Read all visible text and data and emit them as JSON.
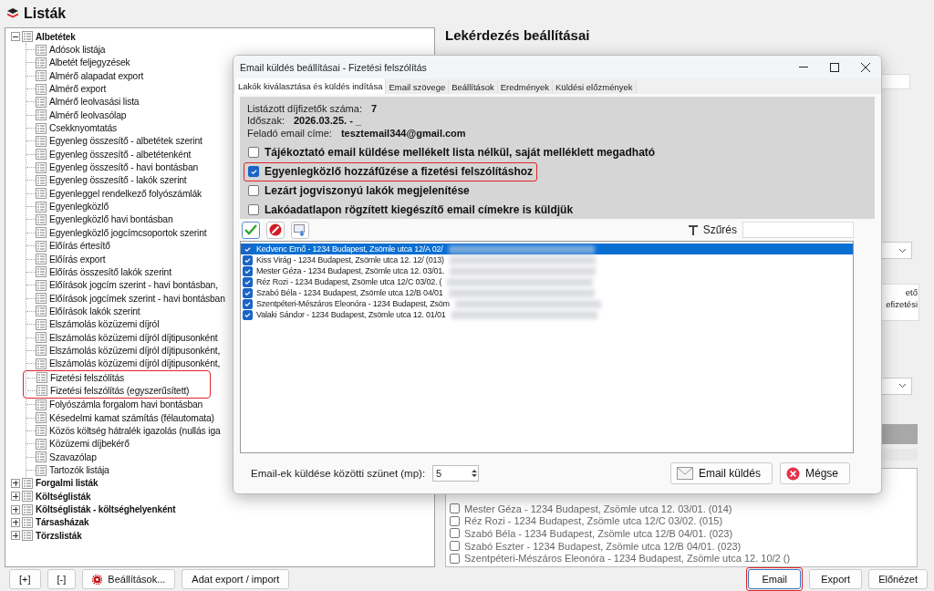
{
  "app": {
    "title": "Listák"
  },
  "tree": [
    {
      "label": "Albetétek",
      "expanded": true,
      "children": [
        {
          "label": "Adósok listája",
          "highlighted": false
        },
        {
          "label": "Albetét feljegyzések",
          "highlighted": false
        },
        {
          "label": "Almérő alapadat export",
          "highlighted": false
        },
        {
          "label": "Almérő export",
          "highlighted": false
        },
        {
          "label": "Almérő leolvasási lista",
          "highlighted": false
        },
        {
          "label": "Almérő leolvasólap",
          "highlighted": false
        },
        {
          "label": "Csekknyomtatás",
          "highlighted": false
        },
        {
          "label": "Egyenleg összesítő - albetétek szerint",
          "highlighted": false
        },
        {
          "label": "Egyenleg összesítő - albetétenként",
          "highlighted": false
        },
        {
          "label": "Egyenleg összesítő - havi bontásban",
          "highlighted": false
        },
        {
          "label": "Egyenleg összesítő - lakók szerint",
          "highlighted": false
        },
        {
          "label": "Egyenleggel rendelkező folyószámlák",
          "highlighted": false
        },
        {
          "label": "Egyenlegközlő",
          "highlighted": false
        },
        {
          "label": "Egyenlegközlő havi bontásban",
          "highlighted": false
        },
        {
          "label": "Egyenlegközlő jogcímcsoportok szerint",
          "highlighted": false
        },
        {
          "label": "Előírás értesítő",
          "highlighted": false
        },
        {
          "label": "Előírás export",
          "highlighted": false
        },
        {
          "label": "Előírás összesítő lakók szerint",
          "highlighted": false
        },
        {
          "label": "Előírások jogcím szerint - havi bontásban,",
          "highlighted": false
        },
        {
          "label": "Előírások jogcímek szerint - havi bontásban",
          "highlighted": false
        },
        {
          "label": "Előírások lakók szerint",
          "highlighted": false
        },
        {
          "label": "Elszámolás közüzemi díjról",
          "highlighted": false
        },
        {
          "label": "Elszámolás közüzemi díjról díjtipusonként",
          "highlighted": false
        },
        {
          "label": "Elszámolás közüzemi díjról díjtipusonként,",
          "highlighted": false
        },
        {
          "label": "Elszámolás közüzemi díjról díjtipusonként,",
          "highlighted": false
        },
        {
          "label": "Fizetési felszólítás",
          "highlighted": true
        },
        {
          "label": "Fizetési felszólítás (egyszerűsített)",
          "highlighted": true
        },
        {
          "label": "Folyószámla forgalom havi bontásban",
          "highlighted": false
        },
        {
          "label": "Késedelmi kamat számítás (félautomata)",
          "highlighted": false
        },
        {
          "label": "Közös költség hátralék igazolás (nullás iga",
          "highlighted": false
        },
        {
          "label": "Közüzemi díjbekérő",
          "highlighted": false
        },
        {
          "label": "Szavazólap",
          "highlighted": false
        },
        {
          "label": "Tartozók listája",
          "highlighted": false
        }
      ]
    },
    {
      "label": "Forgalmi listák",
      "expanded": false
    },
    {
      "label": "Költséglisták",
      "expanded": false
    },
    {
      "label": "Költséglisták - költséghelyenként",
      "expanded": false
    },
    {
      "label": "Társasházak",
      "expanded": false
    },
    {
      "label": "Törzslisták",
      "expanded": false
    }
  ],
  "settings_panel": {
    "title": "Lekérdezés beállításai",
    "note_lines": [
      "ető",
      "efizetési"
    ],
    "recipients": [
      {
        "label": "Mester Géza - 1234 Budapest, Zsömle utca 12. 03/01. (014)",
        "checked": false
      },
      {
        "label": "Réz Rozi - 1234 Budapest, Zsömle utca 12/C 03/02. (015)",
        "checked": false
      },
      {
        "label": "Szabó Béla - 1234 Budapest, Zsömle utca 12/B 04/01. (023)",
        "checked": false
      },
      {
        "label": "Szabó Eszter - 1234 Budapest, Zsömle utca 12/B 04/01. (023)",
        "checked": false
      },
      {
        "label": "Szentpéteri-Mészáros Eleonóra - 1234 Budapest, Zsömle utca 12.  10/2 ()",
        "checked": false
      }
    ]
  },
  "bottom_buttons": [
    {
      "label": "[+]",
      "kind": "plain",
      "highlighted": false
    },
    {
      "label": "[-]",
      "kind": "plain",
      "highlighted": false
    },
    {
      "label": "Beállítások...",
      "kind": "gear",
      "highlighted": false
    },
    {
      "label": "Adat export / import",
      "kind": "plain",
      "highlighted": false
    }
  ],
  "action_buttons": [
    {
      "label": "Email",
      "highlighted": true
    },
    {
      "label": "Export",
      "highlighted": false
    },
    {
      "label": "Előnézet",
      "highlighted": false
    }
  ],
  "dialog": {
    "title": "Email küldés beállításai - Fizetési felszólítás",
    "tabs": [
      {
        "label": "Lakók kiválasztása és küldés indítása",
        "selected": true
      },
      {
        "label": "Email szövege",
        "selected": false
      },
      {
        "label": "Beállítások",
        "selected": false
      },
      {
        "label": "Eredmények",
        "selected": false
      },
      {
        "label": "Küldési előzmények",
        "selected": false
      }
    ],
    "info": [
      {
        "label": "Listázott díjfizetők száma:",
        "value": "7"
      },
      {
        "label": "Időszak:",
        "value": "2026.03.25. - _"
      },
      {
        "label": "Feladó email címe:",
        "value": "tesztemail344@gmail.com"
      }
    ],
    "options": [
      {
        "label": "Tájékoztató email küldése mellékelt lista nélkül, saját melléklett megadható",
        "checked": false,
        "highlighted": false
      },
      {
        "label": "Egyenlegközlő hozzáfűzése a fizetési felszólításhoz",
        "checked": true,
        "highlighted": true
      },
      {
        "label": "Lezárt jogviszonyú lakók megjelenítése",
        "checked": false,
        "highlighted": false
      },
      {
        "label": "Lakóadatlapon rögzített kiegészítő email címekre is küldjük",
        "checked": false,
        "highlighted": false
      }
    ],
    "filter_label": "Szűrés",
    "recipients": [
      {
        "label": "Kedvenc Ernő - 1234 Budapest, Zsömle utca 12/A 02/",
        "checked": true,
        "selected": true
      },
      {
        "label": "Kiss Virág - 1234 Budapest, Zsömle utca 12.  12/ (013)",
        "checked": true,
        "selected": false
      },
      {
        "label": "Mester Géza - 1234 Budapest, Zsömle utca 12. 03/01.",
        "checked": true,
        "selected": false
      },
      {
        "label": "Réz Rozi - 1234 Budapest, Zsömle utca 12/C 03/02. (",
        "checked": true,
        "selected": false
      },
      {
        "label": "Szabó Béla - 1234 Budapest, Zsömle utca 12/B 04/01",
        "checked": true,
        "selected": false
      },
      {
        "label": "Szentpéteri-Mészáros Eleonóra - 1234 Budapest, Zsöm",
        "checked": true,
        "selected": false
      },
      {
        "label": "Valaki Sándor - 1234 Budapest, Zsömle utca 12. 01/01",
        "checked": true,
        "selected": false
      }
    ],
    "delay_label": "Email-ek küldése közötti szünet (mp):",
    "delay_value": "5",
    "buttons": [
      {
        "label": "Email küldés",
        "kind": "mail"
      },
      {
        "label": "Mégse",
        "kind": "cancel"
      }
    ]
  }
}
